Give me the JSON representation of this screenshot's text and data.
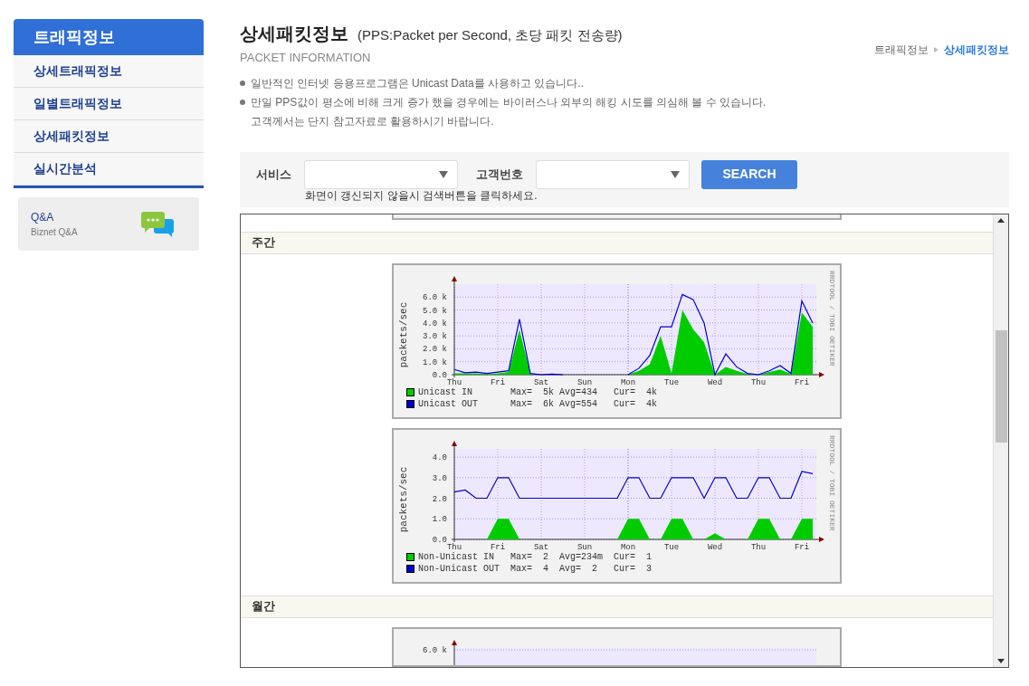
{
  "sidebar": {
    "title": "트래픽정보",
    "items": [
      {
        "label": "상세트래픽정보"
      },
      {
        "label": "일별트래픽정보"
      },
      {
        "label": "상세패킷정보"
      },
      {
        "label": "실시간분석"
      }
    ],
    "qa": {
      "title": "Q&A",
      "subtitle": "Biznet Q&A"
    }
  },
  "header": {
    "title": "상세패킷정보",
    "subtitle": "(PPS:Packet per Second, 초당 패킷 전송량)",
    "caption": "PACKET INFORMATION"
  },
  "breadcrumb": [
    {
      "label": "트래픽정보",
      "selected": false
    },
    {
      "label": "상세패킷정보",
      "selected": true
    }
  ],
  "notes": [
    {
      "lines": [
        "일반적인 인터넷 응용프로그램은 Unicast Data를 사용하고 있습니다.."
      ]
    },
    {
      "lines": [
        "만일 PPS값이 평소에 비해 크게 증가 했을 경우에는 바이러스나 외부의 해킹 시도를 의심해 볼 수 있습니다.",
        "고객께서는 단지 참고자료로 활용하시기 바랍니다."
      ]
    }
  ],
  "search": {
    "fields": [
      {
        "label": "서비스"
      },
      {
        "label": "고객번호"
      }
    ],
    "button": "SEARCH",
    "hint": "화면이 갱신되지 않을시 검색버튼을 클릭하세요."
  },
  "sections": [
    {
      "title": "주간",
      "graphs": [
        {
          "credit": "RRDTOOL / TOBI OETIKER",
          "legend": [
            [
              "Max=  5k",
              "Avg=434",
              "Cur=  4k"
            ],
            [
              "Max=  6k",
              "Avg=554",
              "Cur=  4k"
            ]
          ],
          "chart_data": {
            "type": "area",
            "grid": true,
            "ylabel": "packets/sec",
            "categories": [
              "Thu",
              null,
              null,
              null,
              "Fri",
              null,
              null,
              null,
              "Sat",
              null,
              null,
              null,
              "Sun",
              null,
              null,
              null,
              "Mon",
              null,
              null,
              null,
              "Tue",
              null,
              null,
              null,
              "Wed",
              null,
              null,
              null,
              "Thu",
              null,
              null,
              null,
              "Fri",
              null
            ],
            "ylim": [
              0,
              7000
            ],
            "yticks": [
              {
                "value": 0,
                "label": "0.0"
              },
              {
                "value": 1000,
                "label": "1.0 k"
              },
              {
                "value": 2000,
                "label": "2.0 k"
              },
              {
                "value": 3000,
                "label": "3.0 k"
              },
              {
                "value": 4000,
                "label": "4.0 k"
              },
              {
                "value": 5000,
                "label": "5.0 k"
              },
              {
                "value": 6000,
                "label": "6.0 k"
              }
            ],
            "series": [
              {
                "name": "Unicast IN",
                "color": "#00cc00",
                "values": [
                  100,
                  100,
                  100,
                  50,
                  100,
                  200,
                  3500,
                  50,
                  0,
                  0,
                  0,
                  0,
                  0,
                  0,
                  0,
                  0,
                  0,
                  300,
                  800,
                  3000,
                  100,
                  5000,
                  3500,
                  2500,
                  0,
                  600,
                  300,
                  50,
                  0,
                  200,
                  400,
                  50,
                  4800,
                  3700
                ]
              },
              {
                "name": "Unicast OUT",
                "type": "line",
                "color": "#0000cc",
                "values": [
                  400,
                  150,
                  200,
                  100,
                  200,
                  300,
                  4300,
                  100,
                  0,
                  50,
                  0,
                  null,
                  null,
                  null,
                  null,
                  null,
                  0,
                  500,
                  1500,
                  3700,
                  3700,
                  6200,
                  5800,
                  4000,
                  0,
                  1600,
                  600,
                  100,
                  0,
                  300,
                  700,
                  100,
                  5700,
                  4000
                ]
              }
            ]
          }
        },
        {
          "credit": "RRDTOOL / TOBI OETIKER",
          "legend": [
            [
              "Max=  2",
              "Avg=234m",
              "Cur=  1"
            ],
            [
              "Max=  4",
              "Avg=  2",
              "Cur=  3"
            ]
          ],
          "chart_data": {
            "type": "area",
            "grid": true,
            "ylabel": "packets/sec",
            "categories": [
              "Thu",
              null,
              null,
              null,
              "Fri",
              null,
              null,
              null,
              "Sat",
              null,
              null,
              null,
              "Sun",
              null,
              null,
              null,
              "Mon",
              null,
              null,
              null,
              "Tue",
              null,
              null,
              null,
              "Wed",
              null,
              null,
              null,
              "Thu",
              null,
              null,
              null,
              "Fri",
              null
            ],
            "ylim": [
              0,
              4.4
            ],
            "yticks": [
              {
                "value": 0,
                "label": "0.0"
              },
              {
                "value": 1,
                "label": "1.0"
              },
              {
                "value": 2,
                "label": "2.0"
              },
              {
                "value": 3,
                "label": "3.0"
              },
              {
                "value": 4,
                "label": "4.0"
              }
            ],
            "series": [
              {
                "name": "Non-Unicast IN",
                "color": "#00cc00",
                "values": [
                  0,
                  0,
                  0,
                  0,
                  1,
                  1,
                  0,
                  0,
                  0,
                  0,
                  0,
                  0,
                  0,
                  0,
                  0,
                  0,
                  1,
                  1,
                  0,
                  0,
                  1,
                  1,
                  0,
                  0,
                  0.3,
                  0,
                  0,
                  0,
                  1,
                  1,
                  0,
                  0,
                  1,
                  1
                ]
              },
              {
                "name": "Non-Unicast OUT",
                "type": "line",
                "color": "#0000cc",
                "values": [
                  2.3,
                  2.4,
                  2,
                  2,
                  3,
                  3,
                  2,
                  2,
                  2,
                  2,
                  2,
                  2,
                  2,
                  2,
                  2,
                  2,
                  3,
                  3,
                  2,
                  2,
                  3,
                  3,
                  3,
                  2,
                  3,
                  3,
                  2,
                  2,
                  3,
                  3,
                  2,
                  2,
                  3.3,
                  3.2
                ]
              }
            ]
          }
        }
      ]
    },
    {
      "title": "월간",
      "graphs": [
        {
          "kind": "partial",
          "tick_label": "6.0 k"
        }
      ]
    }
  ]
}
